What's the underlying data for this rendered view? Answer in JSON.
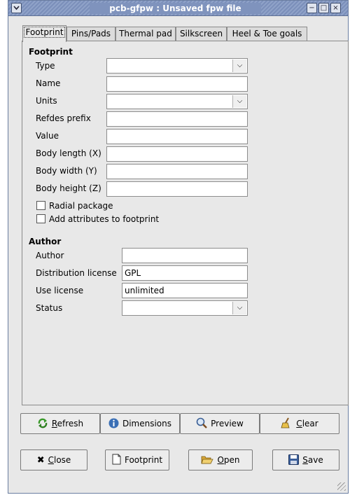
{
  "window": {
    "title": "pcb-gfpw : Unsaved fpw file",
    "menu_icon": "window-menu-icon",
    "controls": {
      "minimize": "−",
      "maximize": "□",
      "close": "×"
    }
  },
  "tabs": [
    {
      "label": "Footprint",
      "active": true
    },
    {
      "label": "Pins/Pads",
      "active": false
    },
    {
      "label": "Thermal pad",
      "active": false
    },
    {
      "label": "Silkscreen",
      "active": false
    },
    {
      "label": "Heel & Toe goals",
      "active": false
    }
  ],
  "footprint": {
    "heading": "Footprint",
    "type_label": "Type",
    "type_value": "",
    "name_label": "Name",
    "name_value": "",
    "units_label": "Units",
    "units_value": "",
    "refdes_label": "Refdes prefix",
    "refdes_value": "",
    "value_label": "Value",
    "value_value": "",
    "body_length_label": "Body length (X)",
    "body_length_value": "",
    "body_width_label": "Body width (Y)",
    "body_width_value": "",
    "body_height_label": "Body height (Z)",
    "body_height_value": "",
    "radial_label": "Radial package",
    "radial_checked": false,
    "attributes_label": "Add attributes to footprint",
    "attributes_checked": false
  },
  "author": {
    "heading": "Author",
    "author_label": "Author",
    "author_value": "",
    "dist_license_label": "Distribution license",
    "dist_license_value": "GPL",
    "use_license_label": "Use license",
    "use_license_value": "unlimited",
    "status_label": "Status",
    "status_value": ""
  },
  "buttons_row1": {
    "refresh": {
      "label": "Refresh",
      "mnemonic": "R",
      "icon": "refresh-icon"
    },
    "dimensions": {
      "label": "Dimensions",
      "icon": "info-icon"
    },
    "preview": {
      "label": "Preview",
      "icon": "magnifier-icon"
    },
    "clear": {
      "label": "Clear",
      "mnemonic": "C",
      "icon": "broom-icon"
    }
  },
  "buttons_row2": {
    "close": {
      "label": "Close",
      "mnemonic": "C",
      "icon": "close-x-icon"
    },
    "footprint": {
      "label": "Footprint",
      "icon": "new-document-icon"
    },
    "open": {
      "label": "Open",
      "mnemonic": "O",
      "icon": "folder-open-icon"
    },
    "save": {
      "label": "Save",
      "mnemonic": "S",
      "icon": "floppy-disk-icon"
    }
  },
  "colors": {
    "titlebar": "#7f93bd",
    "window_bg": "#e8e8e8",
    "refresh_green": "#3a9a2a",
    "info_blue": "#3a6fb5",
    "folder_yellow": "#e8c04a"
  }
}
